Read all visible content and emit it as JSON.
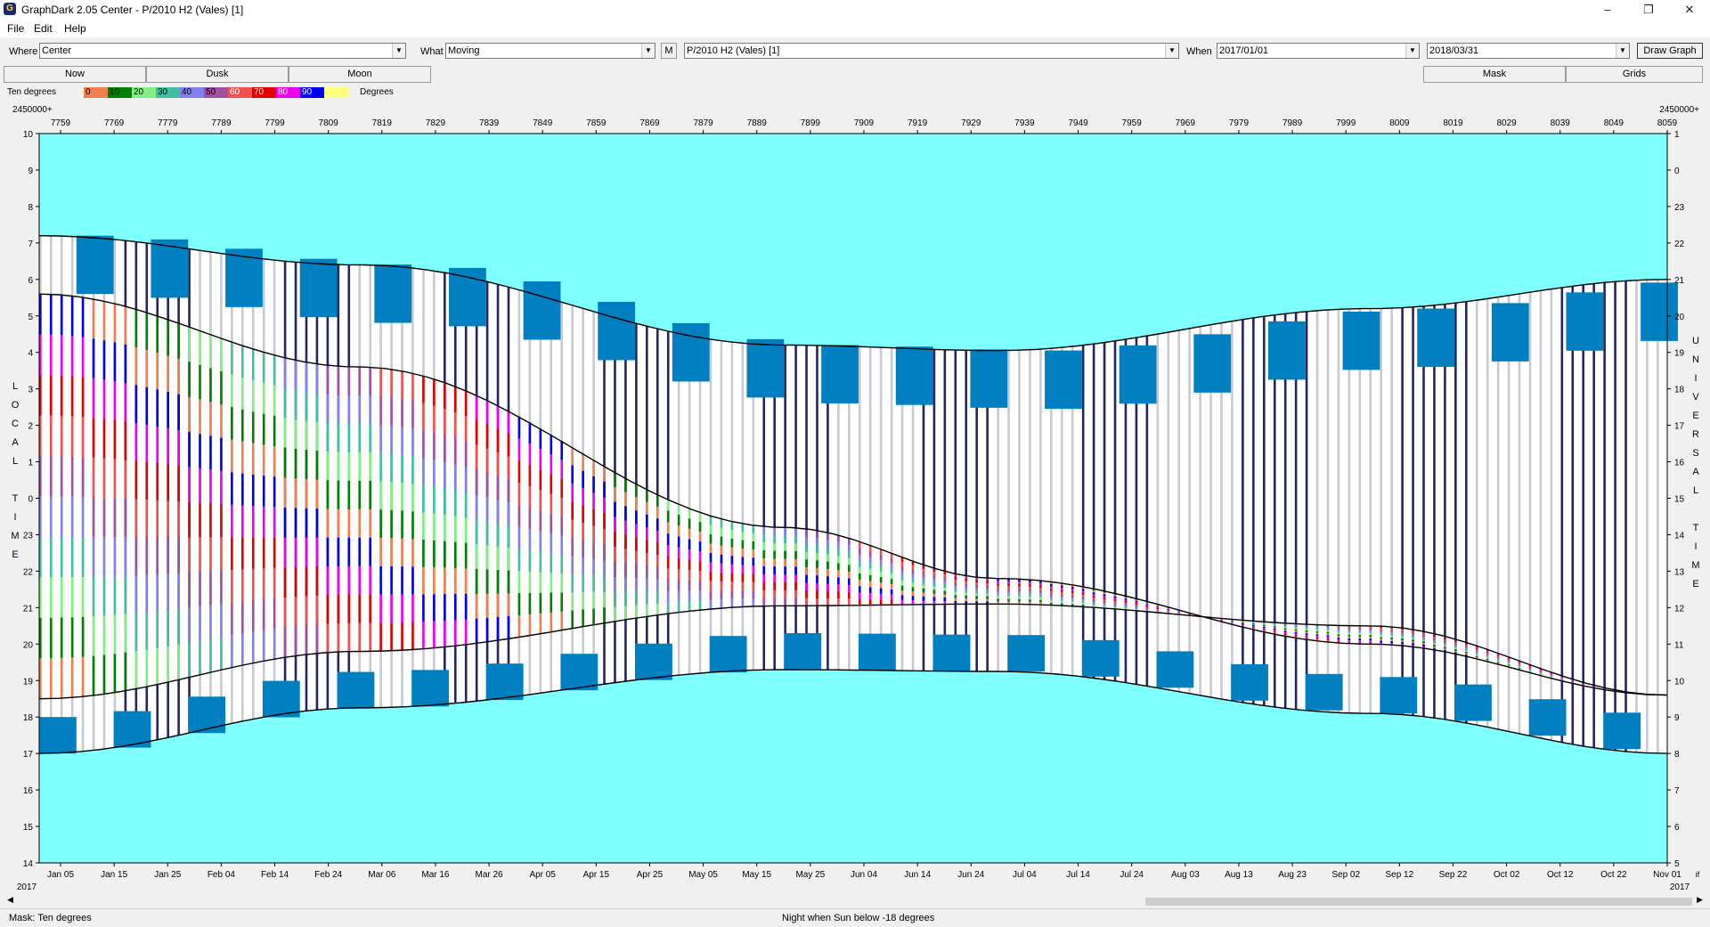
{
  "window": {
    "title": "GraphDark 2.05  Center  -  P/2010 H2 (Vales) [1]",
    "minimize": "–",
    "maximize": "❐",
    "close": "✕"
  },
  "menu": {
    "file": "File",
    "edit": "Edit",
    "help": "Help"
  },
  "toolbar": {
    "where_label": "Where",
    "where_value": "Center",
    "what_label": "What",
    "what_value": "Moving",
    "m_button": "M",
    "object_value": "P/2010 H2 (Vales) [1]",
    "when_label": "When",
    "start_date": "2017/01/01",
    "end_date": "2018/03/31",
    "draw_button": "Draw Graph"
  },
  "buttons": {
    "now": "Now",
    "dusk": "Dusk",
    "moon": "Moon",
    "mask": "Mask",
    "grids": "Grids"
  },
  "legend": {
    "label": "Ten degrees",
    "unit": "Degrees",
    "bins": [
      {
        "label": "0",
        "color": "#f08050"
      },
      {
        "label": "10",
        "color": "#008000"
      },
      {
        "label": "20",
        "color": "#80f080"
      },
      {
        "label": "30",
        "color": "#40c0a0"
      },
      {
        "label": "40",
        "color": "#8080f0"
      },
      {
        "label": "50",
        "color": "#a050a0"
      },
      {
        "label": "60",
        "color": "#f05050"
      },
      {
        "label": "70",
        "color": "#e00000"
      },
      {
        "label": "80",
        "color": "#f000f0"
      },
      {
        "label": "90",
        "color": "#0000f0"
      },
      {
        "label": "",
        "color": "#ffff80"
      }
    ]
  },
  "colors": {
    "twilight": "#ffffff",
    "night_sky": "#000040",
    "day_sky": "#80ffff",
    "sun_band": "#0080c0"
  },
  "status": {
    "mask": "Mask:  Ten degrees",
    "night": "Night when Sun below -18 degrees"
  },
  "chart_data": {
    "type": "heatmap",
    "title": "",
    "jd_prefix_left": "2450000+",
    "jd_prefix_right": "2450000+",
    "top_ticks": [
      "7759",
      "7769",
      "7779",
      "7789",
      "7799",
      "7809",
      "7819",
      "7829",
      "7839",
      "7849",
      "7859",
      "7869",
      "7879",
      "7889",
      "7899",
      "7909",
      "7919",
      "7929",
      "7939",
      "7949",
      "7959",
      "7969",
      "7979",
      "7989",
      "7999",
      "8009",
      "8019",
      "8029",
      "8039",
      "8049",
      "8059"
    ],
    "bottom_ticks": [
      "Jan 05",
      "Jan 15",
      "Jan 25",
      "Feb 04",
      "Feb 14",
      "Feb 24",
      "Mar 06",
      "Mar 16",
      "Mar 26",
      "Apr 05",
      "Apr 15",
      "Apr 25",
      "May 05",
      "May 15",
      "May 25",
      "Jun 04",
      "Jun 14",
      "Jun 24",
      "Jul 04",
      "Jul 14",
      "Jul 24",
      "Aug 03",
      "Aug 13",
      "Aug 23",
      "Sep 02",
      "Sep 12",
      "Sep 22",
      "Oct 02",
      "Oct 12",
      "Oct 22",
      "Nov 01"
    ],
    "year_left": "2017",
    "year_right": "2017",
    "right_corner": "if",
    "left_axis_ticks": [
      "10",
      "9",
      "8",
      "7",
      "6",
      "5",
      "4",
      "3",
      "2",
      "1",
      "0",
      "23",
      "22",
      "21",
      "20",
      "19",
      "18",
      "17",
      "16",
      "15",
      "14"
    ],
    "right_axis_ticks": [
      "1",
      "0",
      "23",
      "22",
      "21",
      "20",
      "19",
      "18",
      "17",
      "16",
      "15",
      "14",
      "13",
      "12",
      "11",
      "10",
      "9",
      "8",
      "7",
      "6",
      "5"
    ],
    "left_axis_label": "LOCAL TIME",
    "right_axis_label": "UNIVERSAL TIME",
    "x_range_days": [
      0,
      306
    ],
    "y_range_hours_local": [
      14,
      34
    ],
    "sunset_local_hours": [
      17.0,
      18.25,
      19.3,
      19.25,
      18.1,
      17.0
    ],
    "sunrise_local_hours": [
      31.2,
      30.4,
      28.2,
      28.05,
      29.2,
      30.0
    ],
    "object_set_local_hours": [
      29.6,
      27.6,
      23.2,
      21.8,
      20.0,
      18.6
    ],
    "object_rise_local_hours": [
      18.5,
      19.8,
      21.05,
      21.1,
      20.5,
      18.6
    ],
    "curve_days": [
      0,
      60,
      140,
      180,
      250,
      306
    ]
  }
}
